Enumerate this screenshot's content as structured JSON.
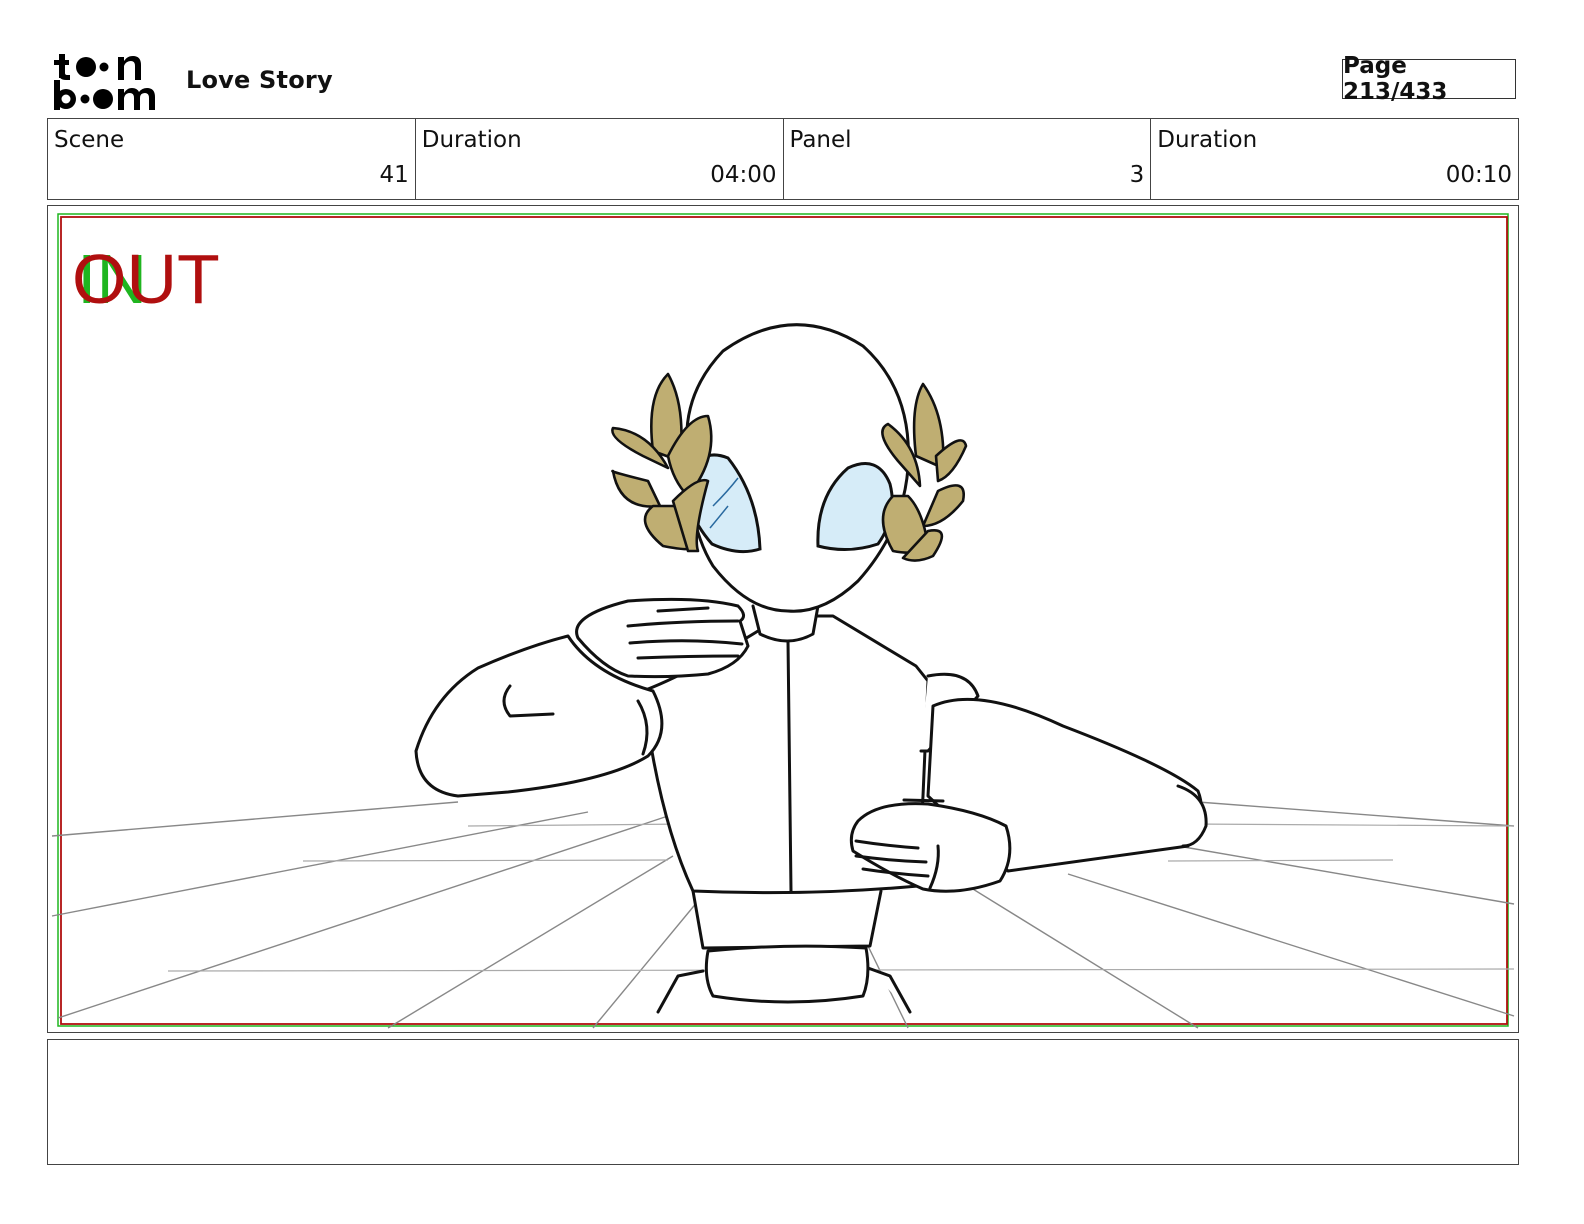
{
  "header": {
    "title": "Love Story",
    "page_label": "Page 213/433"
  },
  "info": {
    "scene_label": "Scene",
    "scene_value": "41",
    "scene_duration_label": "Duration",
    "scene_duration_value": "04:00",
    "panel_label": "Panel",
    "panel_value": "3",
    "panel_duration_label": "Duration",
    "panel_duration_value": "00:10"
  },
  "panel": {
    "in_mark": "IN",
    "out_mark": "OUT"
  },
  "colors": {
    "in_green": "#1fb51f",
    "out_red": "#b00f0f",
    "laurel": "#bfae72",
    "eye_blue": "#d6ecf8"
  },
  "notes": {
    "text": ""
  }
}
